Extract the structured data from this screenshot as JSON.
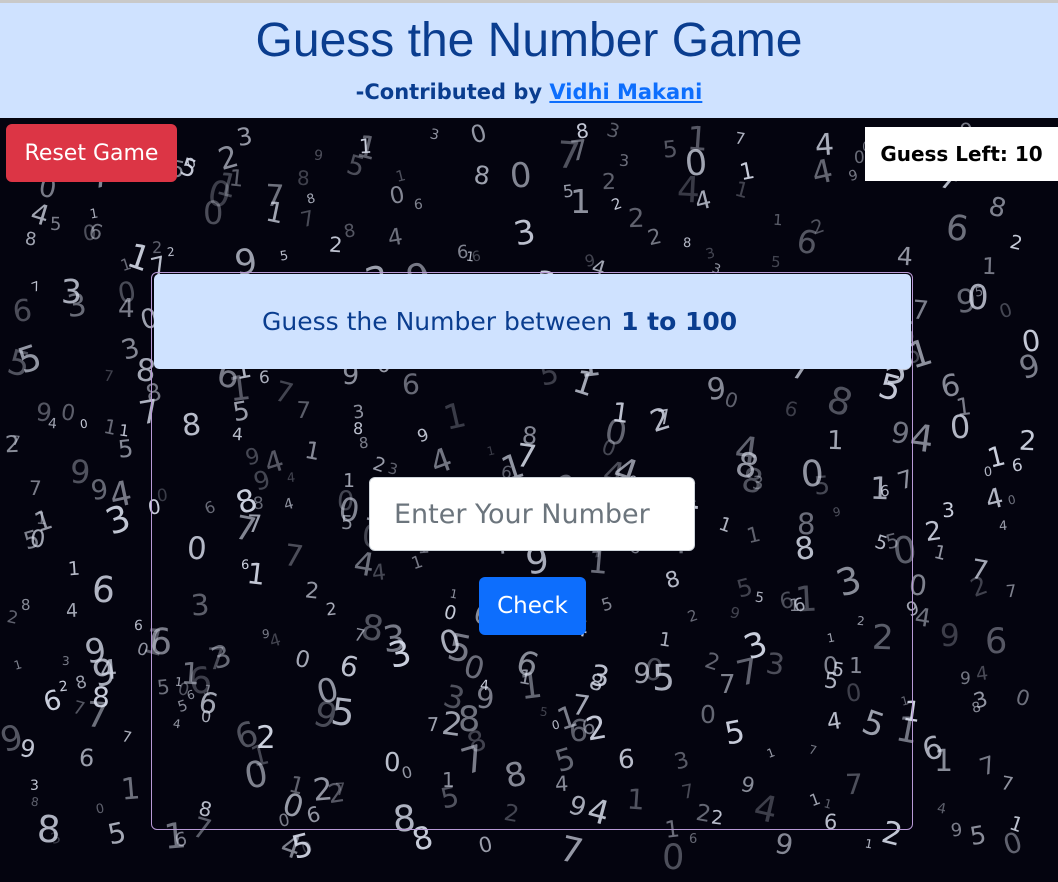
{
  "header": {
    "title": "Guess the Number Game",
    "contributed_prefix": "-Contributed by",
    "author": "Vidhi Makani"
  },
  "controls": {
    "reset_label": "Reset Game",
    "guess_left_label": "Guess Left:",
    "guess_left_value": "10"
  },
  "card": {
    "prompt_text": "Guess the Number between",
    "range_text": "1 to 100",
    "input_value": "",
    "input_placeholder": "Enter Your Number",
    "check_label": "Check"
  },
  "background_digits": "0123456789",
  "colors": {
    "header_bg": "#cfe2ff",
    "title_color": "#0a3d8f",
    "reset_button": "#dc3545",
    "check_button": "#0d6efd",
    "card_border": "#b89ad6",
    "page_bg": "#04040f"
  }
}
